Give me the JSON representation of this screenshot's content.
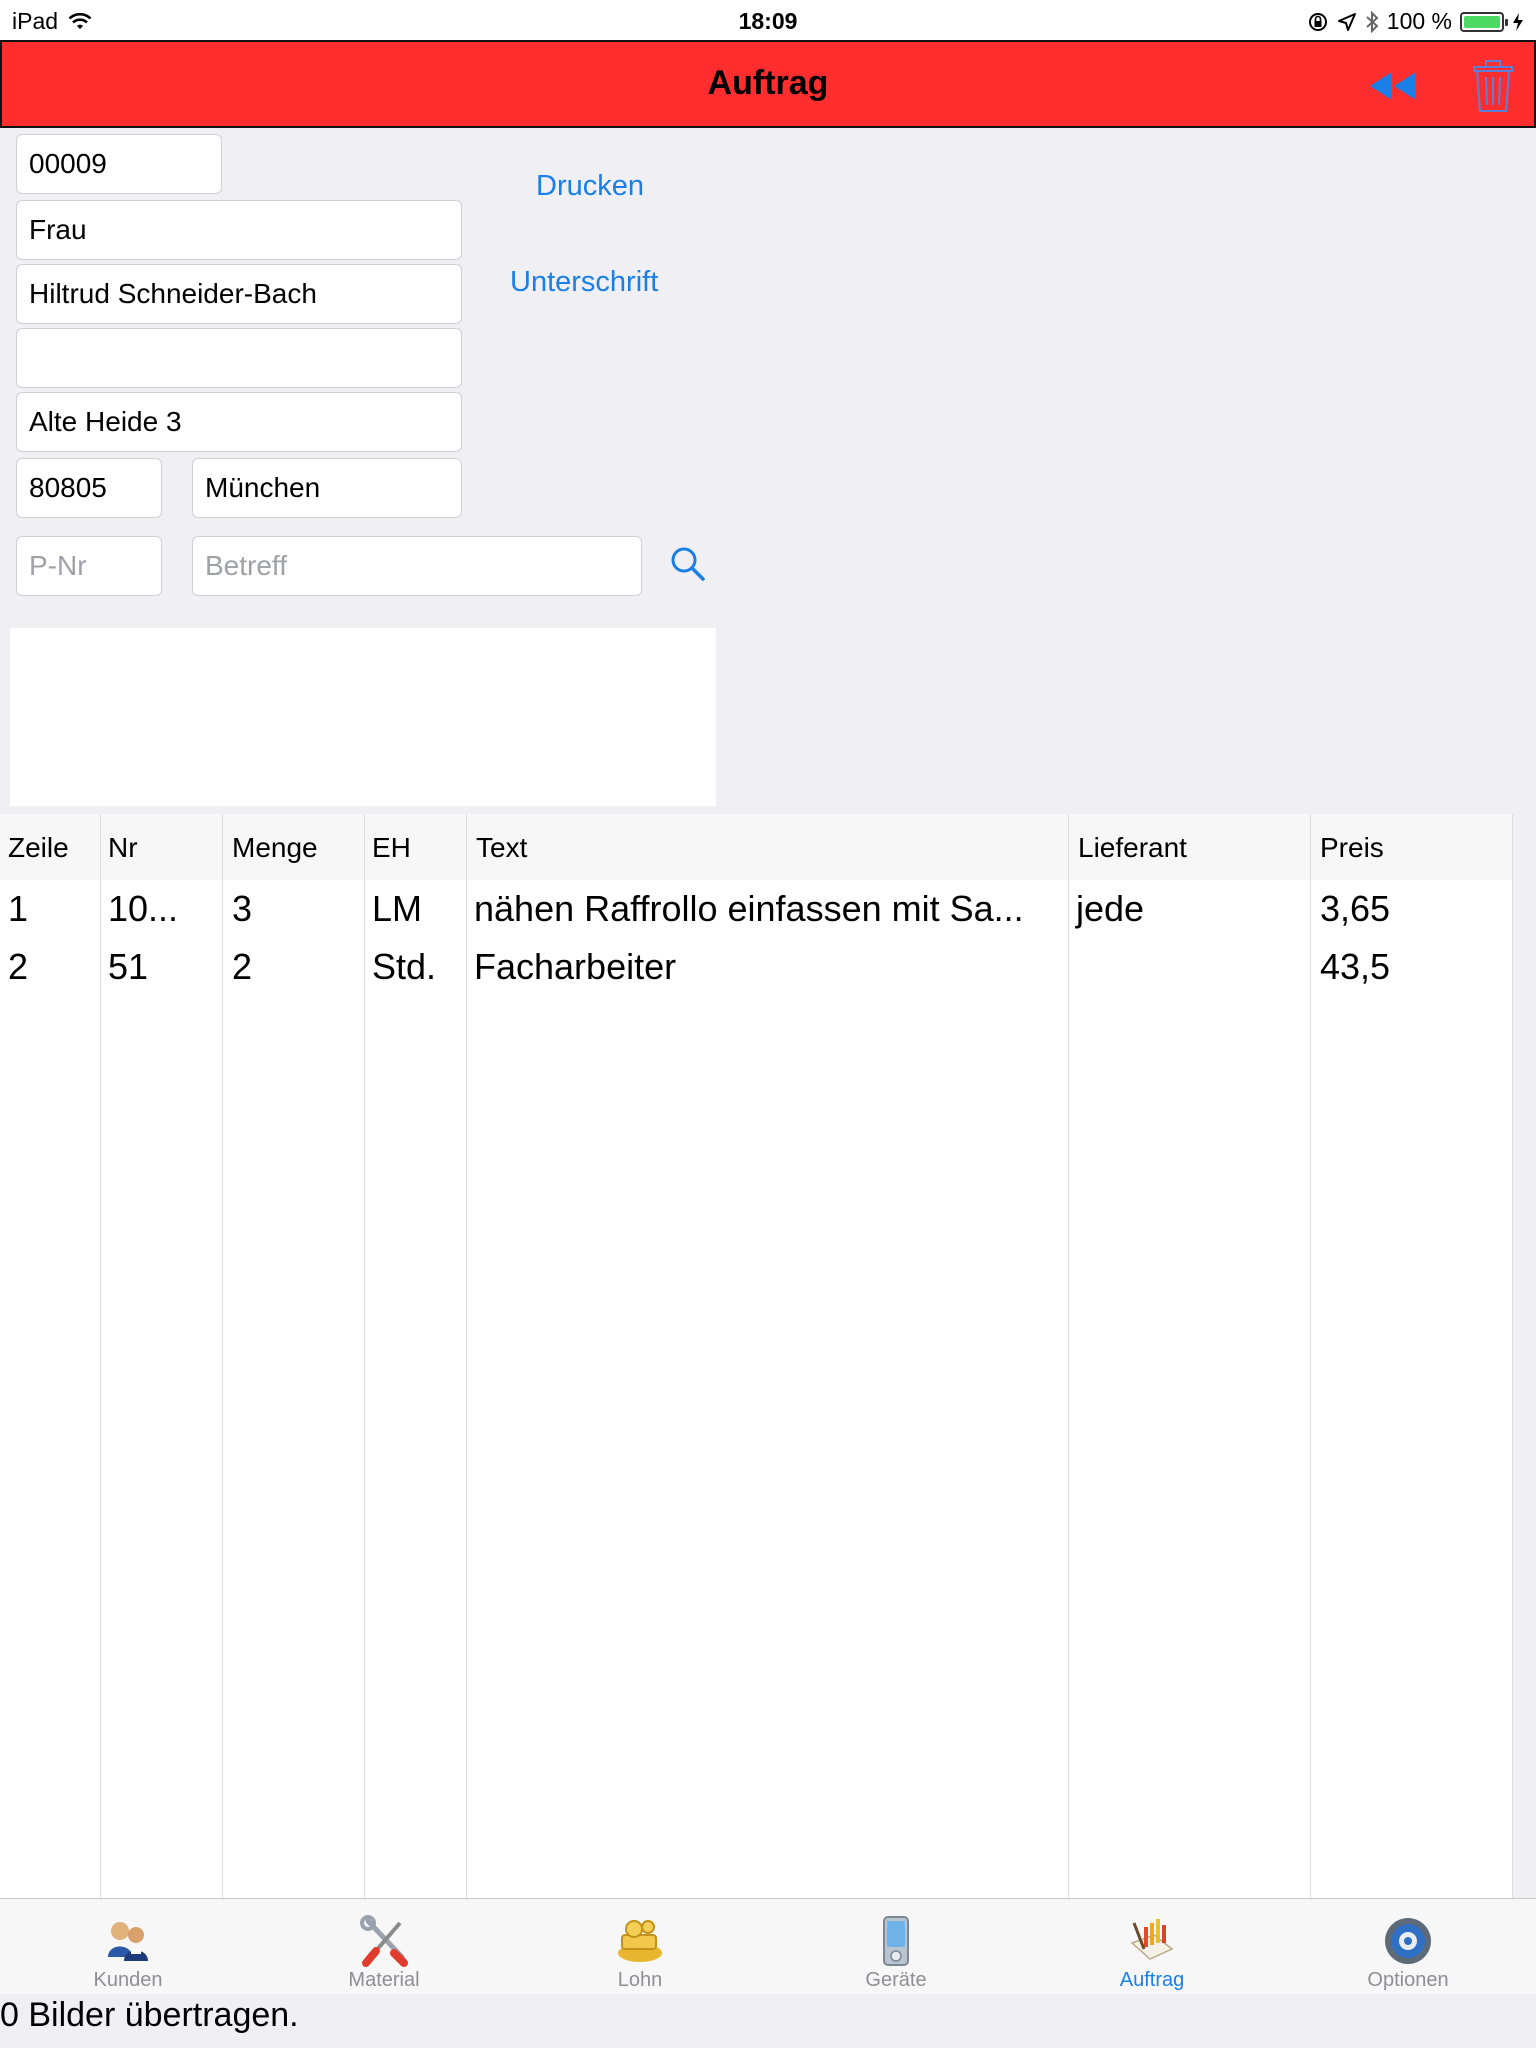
{
  "status": {
    "device": "iPad",
    "time": "18:09",
    "battery": "100 %",
    "battery_level": 1.0
  },
  "navbar": {
    "title": "Auftrag"
  },
  "form": {
    "number": "00009",
    "salutation": "Frau",
    "name": "Hiltrud Schneider-Bach",
    "name2": "",
    "street": "Alte Heide 3",
    "zip": "80805",
    "city": "München",
    "pnr_placeholder": "P-Nr",
    "subject_placeholder": "Betreff"
  },
  "actions": {
    "print": "Drucken",
    "signature": "Unterschrift"
  },
  "table": {
    "headers": [
      "Zeile",
      "Nr",
      "Menge",
      "EH",
      "Text",
      "Lieferant",
      "Preis"
    ],
    "rows": [
      [
        "1",
        "10...",
        "3",
        "LM",
        "nähen Raffrollo einfassen mit Sa...",
        "jede",
        "3,65"
      ],
      [
        "2",
        "51",
        "2",
        "Std.",
        "Facharbeiter",
        "",
        "43,5"
      ]
    ]
  },
  "tabs": [
    {
      "label": "Kunden",
      "icon": "customers-icon"
    },
    {
      "label": "Material",
      "icon": "tools-icon"
    },
    {
      "label": "Lohn",
      "icon": "money-icon"
    },
    {
      "label": "Geräte",
      "icon": "device-icon"
    },
    {
      "label": "Auftrag",
      "icon": "order-icon",
      "active": true
    },
    {
      "label": "Optionen",
      "icon": "options-icon"
    }
  ],
  "footer": {
    "status": "0 Bilder übertragen."
  },
  "colors": {
    "navbar": "#ff2d2d",
    "accent": "#1a7fe6",
    "background": "#efeff4"
  }
}
